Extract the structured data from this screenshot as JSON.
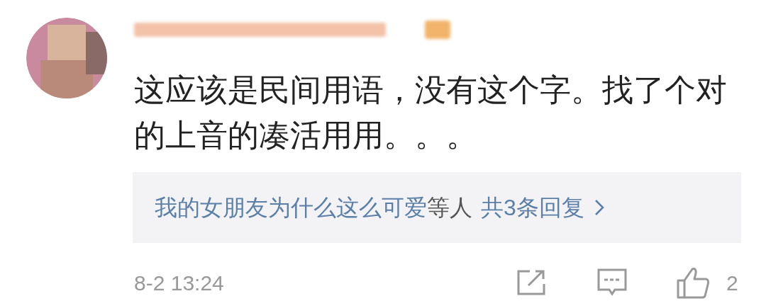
{
  "comment": {
    "text": "这应该是民间用语，没有这个字。找了个对的上音的凑活用用。。。"
  },
  "replies": {
    "names": "我的女朋友为什么这么可爱",
    "suffix": "等人",
    "count": "共3条回复"
  },
  "footer": {
    "time": "8-2 13:24",
    "likes": "2"
  }
}
